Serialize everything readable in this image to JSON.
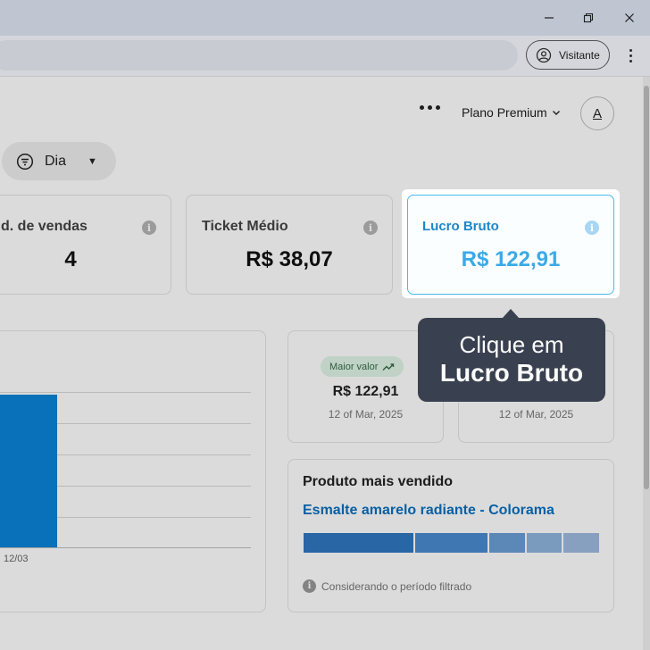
{
  "browser": {
    "profile_label": "Visitante",
    "window_controls": [
      "minimize-icon",
      "restore-icon",
      "close-icon"
    ]
  },
  "header": {
    "plan_label": "Plano Premium",
    "avatar_letter": "A"
  },
  "filter": {
    "label": "Dia"
  },
  "kpis": [
    {
      "label": "d. de vendas",
      "value": "4"
    },
    {
      "label": "Ticket Médio",
      "value": "R$ 38,07"
    },
    {
      "label": "Lucro Bruto",
      "value": "R$ 122,91"
    }
  ],
  "chart": {
    "x_tick": "12/03"
  },
  "chart_data": {
    "type": "bar",
    "categories": [
      "12/03"
    ],
    "series": [
      {
        "values": [
          122.91
        ]
      }
    ],
    "grid": true
  },
  "stats": [
    {
      "badge": "Maior valor",
      "value": "R$ 122,91",
      "date": "12 of Mar, 2025"
    },
    {
      "date": "12 of Mar, 2025"
    }
  ],
  "product": {
    "title": "Produto mais vendido",
    "name": "Esmalte amarelo radiante - Colorama",
    "note": "Considerando o período filtrado",
    "segment_colors": [
      "#2f77c2",
      "#4a8bd0",
      "#6a9fd6",
      "#8fb4de",
      "#9fbbe0"
    ]
  },
  "tooltip": {
    "line1": "Clique em",
    "line2": "Lucro Bruto"
  },
  "colors": {
    "accent": "#1c86c9",
    "tooltip_bg": "#394150",
    "bar": "#0a84d8"
  }
}
